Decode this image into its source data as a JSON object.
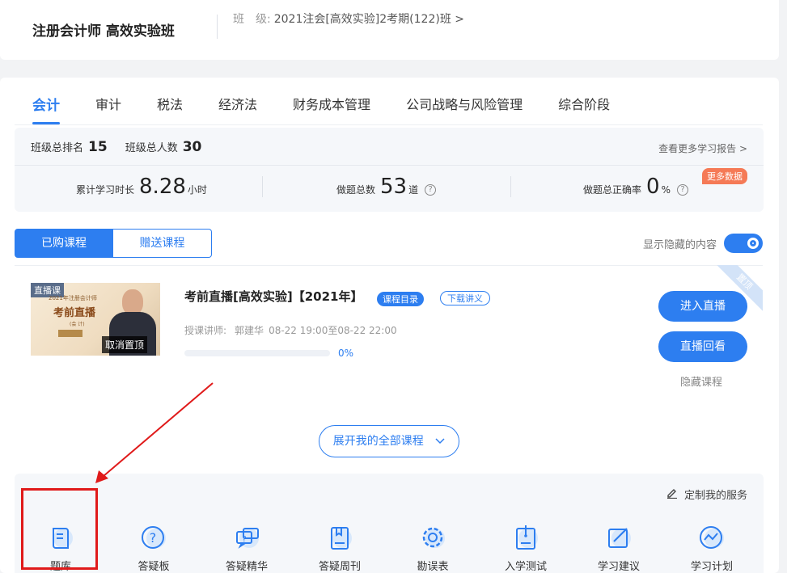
{
  "header": {
    "course_name": "注册会计师 高效实验班",
    "class_label": "班　级:",
    "class_value": "2021注会[高效实验]2考期(122)班 >"
  },
  "tabs": [
    {
      "label": "会计",
      "active": true
    },
    {
      "label": "审计"
    },
    {
      "label": "税法"
    },
    {
      "label": "经济法"
    },
    {
      "label": "财务成本管理"
    },
    {
      "label": "公司战略与风险管理"
    },
    {
      "label": "综合阶段"
    }
  ],
  "stats": {
    "rank_label": "班级总排名",
    "rank_value": "15",
    "total_label": "班级总人数",
    "total_value": "30",
    "more_report": "查看更多学习报告 >",
    "study_time_label": "累计学习时长",
    "study_time_value": "8.28",
    "study_time_unit": "小时",
    "questions_label": "做题总数",
    "questions_value": "53",
    "questions_unit": "道",
    "accuracy_label": "做题总正确率",
    "accuracy_value": "0",
    "accuracy_unit": "%",
    "more_data": "更多数据",
    "help_glyph": "?"
  },
  "segments": {
    "purchased": "已购课程",
    "gifted": "赠送课程",
    "show_hidden": "显示隐藏的内容"
  },
  "course": {
    "thumb_tag": "直播课",
    "thumb_small_title": "2021年注册会计师",
    "thumb_main_title": "考前直播",
    "thumb_sub": "(会 计)",
    "cancel_pin": "取消置顶",
    "title": "考前直播[高效实验]【2021年】",
    "catalog_badge": "课程目录",
    "download_badge": "下载讲义",
    "teacher_label": "授课讲师:",
    "teacher_name": "郭建华",
    "schedule": "08-22 19:00至08-22 22:00",
    "progress": 0,
    "progress_text": "0%",
    "enter_live": "进入直播",
    "replay": "直播回看",
    "hide_course": "隐藏课程",
    "pinned_ribbon": "置顶"
  },
  "expand_label": "展开我的全部课程",
  "services": {
    "customize": "定制我的服务",
    "items": [
      {
        "label": "题库",
        "icon": "question-bank-icon"
      },
      {
        "label": "答疑板",
        "icon": "question-board-icon"
      },
      {
        "label": "答疑精华",
        "icon": "qa-highlights-icon"
      },
      {
        "label": "答疑周刊",
        "icon": "weekly-journal-icon"
      },
      {
        "label": "勘误表",
        "icon": "errata-gear-icon"
      },
      {
        "label": "入学测试",
        "icon": "entrance-test-icon"
      },
      {
        "label": "学习建议",
        "icon": "study-advice-icon"
      },
      {
        "label": "学习计划",
        "icon": "study-plan-icon"
      }
    ]
  },
  "colors": {
    "primary": "#2d7ef0",
    "highlight_red": "#e01a1a",
    "more_data_orange": "#f57a56"
  }
}
